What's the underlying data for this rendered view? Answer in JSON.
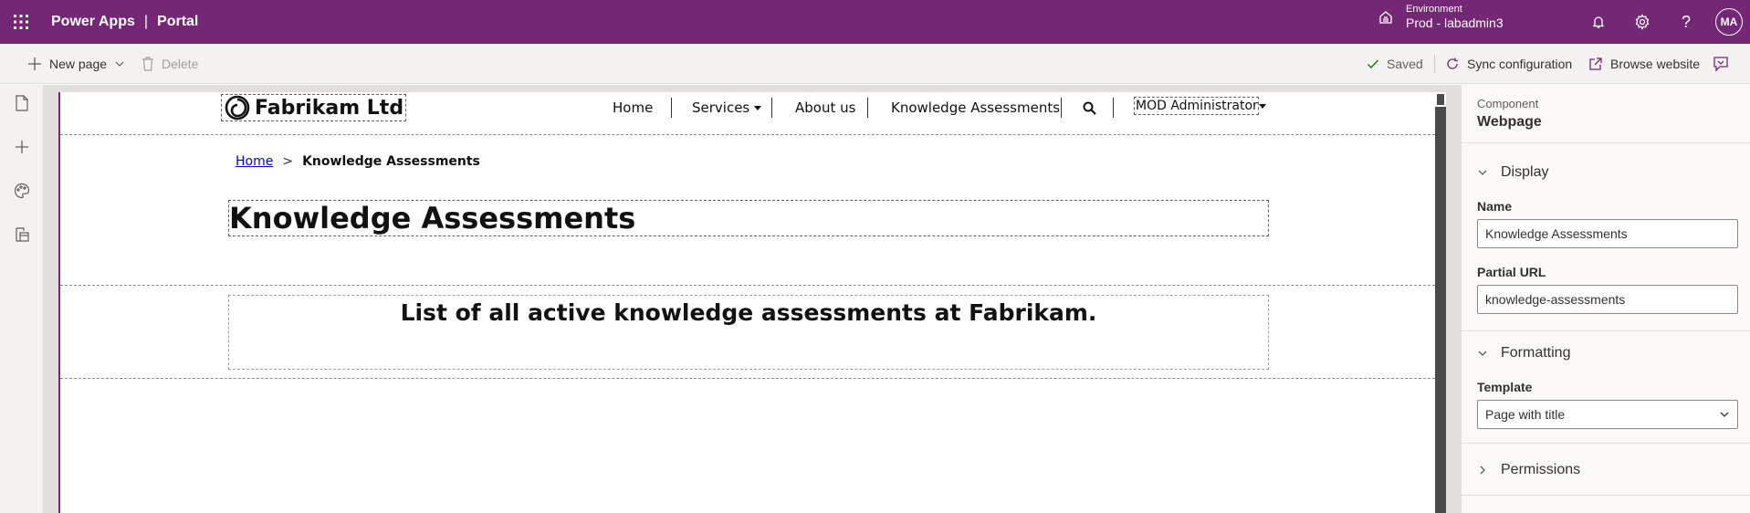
{
  "header": {
    "app_name": "Power Apps",
    "separator": "|",
    "app_section": "Portal",
    "environment_label": "Environment",
    "environment_value": "Prod - labadmin3",
    "avatar_initials": "MA",
    "accent_color": "#742774"
  },
  "command_bar": {
    "new_page": "New page",
    "delete": "Delete",
    "saved": "Saved",
    "sync": "Sync configuration",
    "browse": "Browse website"
  },
  "rail": {
    "icons": [
      "page-icon",
      "add-icon",
      "theme-icon",
      "components-icon"
    ]
  },
  "site": {
    "logo_text": "Fabrikam Ltd",
    "nav": {
      "home": "Home",
      "services": "Services",
      "about": "About us",
      "knowledge": "Knowledge Assessments"
    },
    "user_menu": "MOD Administrator",
    "breadcrumb": {
      "home": "Home",
      "separator": ">",
      "current": "Knowledge Assessments"
    },
    "page_title": "Knowledge Assessments",
    "content_text": "List of all active knowledge assessments at Fabrikam."
  },
  "panel": {
    "kicker": "Component",
    "title": "Webpage",
    "display": {
      "heading": "Display",
      "name_label": "Name",
      "name_value": "Knowledge Assessments",
      "url_label": "Partial URL",
      "url_value": "knowledge-assessments"
    },
    "formatting": {
      "heading": "Formatting",
      "template_label": "Template",
      "template_value": "Page with title"
    },
    "permissions": {
      "heading": "Permissions"
    }
  }
}
